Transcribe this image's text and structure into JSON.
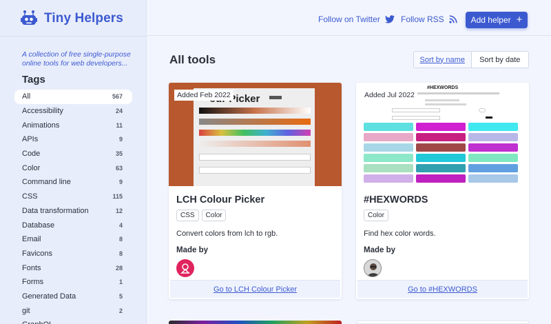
{
  "brand": {
    "name": "Tiny Helpers",
    "tagline": "A collection of free single-purpose online tools for web developers..."
  },
  "header": {
    "twitter_label": "Follow on Twitter",
    "rss_label": "Follow RSS",
    "add_label": "Add helper"
  },
  "sidebar": {
    "heading": "Tags",
    "items": [
      {
        "label": "All",
        "count": "567",
        "active": true
      },
      {
        "label": "Accessibility",
        "count": "24"
      },
      {
        "label": "Animations",
        "count": "11"
      },
      {
        "label": "APIs",
        "count": "9"
      },
      {
        "label": "Code",
        "count": "35"
      },
      {
        "label": "Color",
        "count": "63"
      },
      {
        "label": "Command line",
        "count": "9"
      },
      {
        "label": "CSS",
        "count": "115"
      },
      {
        "label": "Data transformation",
        "count": "12"
      },
      {
        "label": "Database",
        "count": "4"
      },
      {
        "label": "Email",
        "count": "8"
      },
      {
        "label": "Favicons",
        "count": "8"
      },
      {
        "label": "Fonts",
        "count": "28"
      },
      {
        "label": "Forms",
        "count": "1"
      },
      {
        "label": "Generated Data",
        "count": "5"
      },
      {
        "label": "git",
        "count": "2"
      },
      {
        "label": "GraphQL",
        "count": ""
      }
    ]
  },
  "main": {
    "title": "All tools",
    "sort": {
      "by_name": "Sort by name",
      "by_date": "Sort by date"
    },
    "cards": [
      {
        "added": "Added Feb 2022",
        "title": "LCH Colour Picker",
        "tags": [
          "CSS",
          "Color"
        ],
        "description": "Convert colors from lch to rgb.",
        "made_by": "Made by",
        "link": "Go to LCH Colour Picker",
        "thumb_text": "our Picker"
      },
      {
        "added": "Added Jul 2022",
        "title": "#HEXWORDS",
        "tags": [
          "Color"
        ],
        "description": "Find hex color words.",
        "made_by": "Made by",
        "link": "Go to #HEXWORDS",
        "thumb_text": "#HEXWORDS"
      }
    ]
  },
  "colors": {
    "accent": "#3c5ad0",
    "sidebar_bg": "#e8edfb",
    "page_bg": "#f2f5fd",
    "lch_thumb": "#b8582f"
  }
}
